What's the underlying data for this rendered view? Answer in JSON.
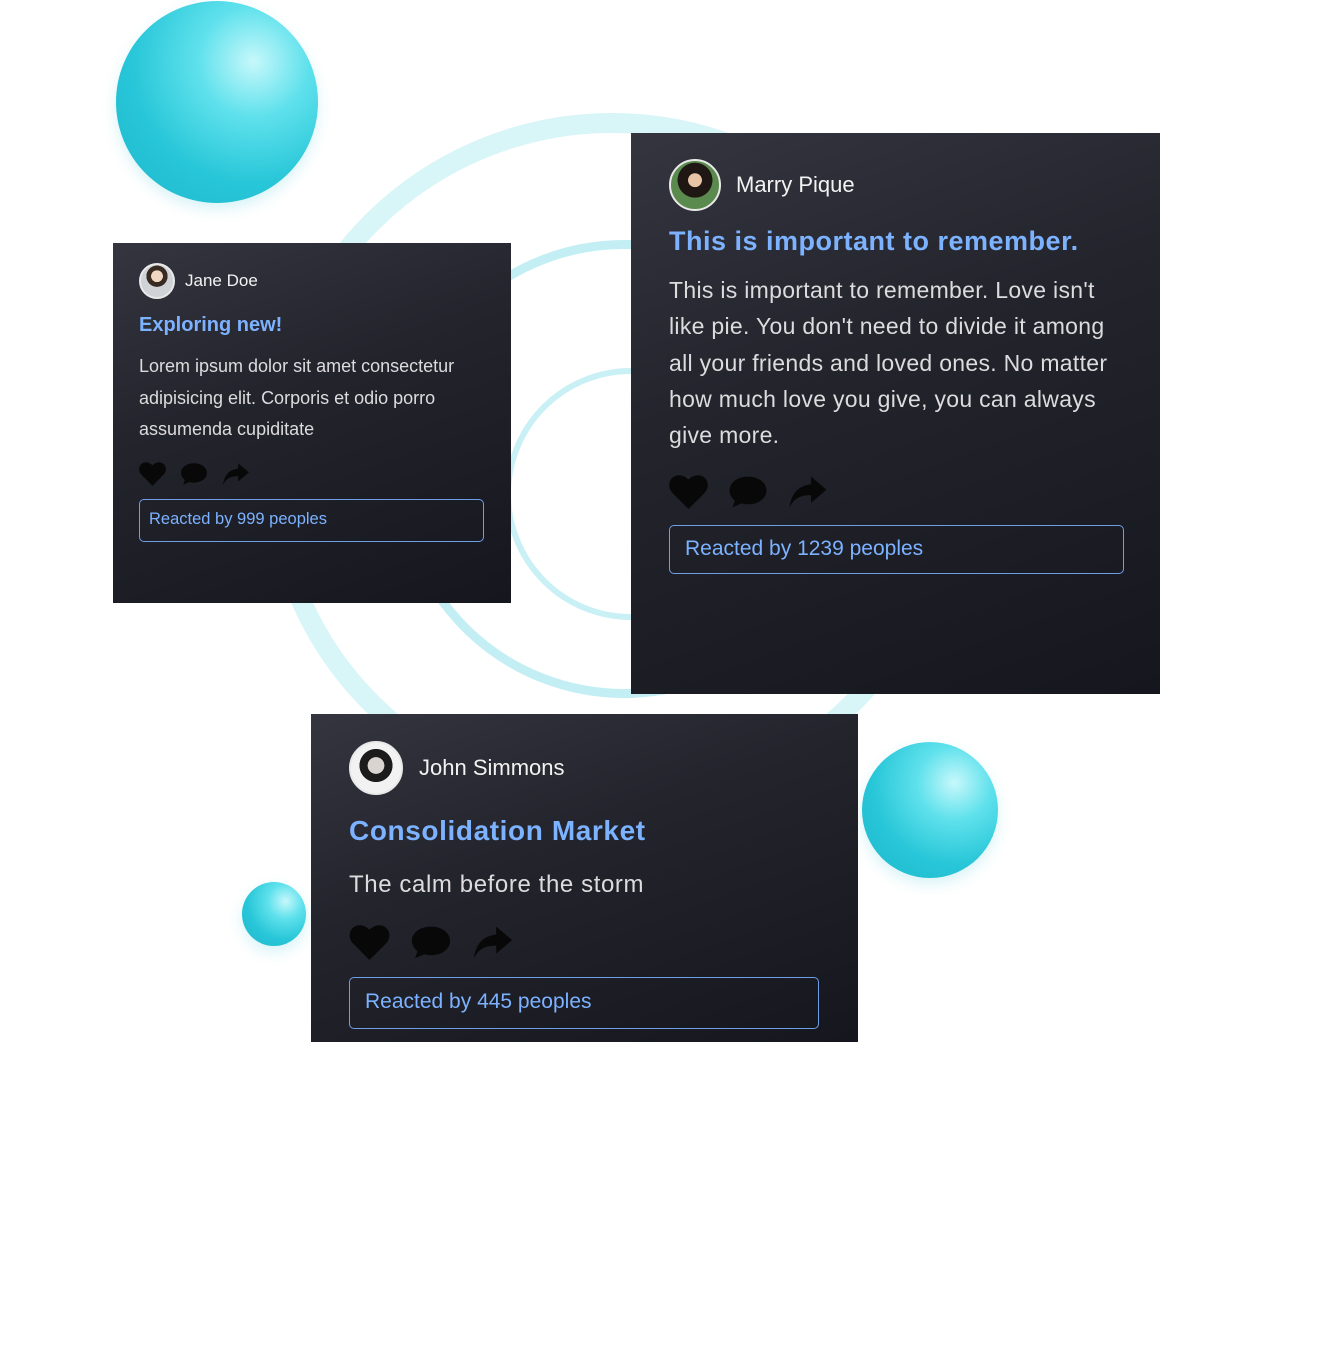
{
  "colors": {
    "card_background": "#23242c",
    "accent_blue": "#7cb2ff",
    "sphere_cyan": "#27c6d8",
    "ring_cyan": "#c6f1f6",
    "text_light": "#dcdcde"
  },
  "cards": [
    {
      "author": "Jane Doe",
      "title": "Exploring new!",
      "body": "Lorem ipsum dolor sit amet consectetur adipisicing elit. Corporis et odio porro assumenda cupiditate",
      "reacted": "Reacted by 999 peoples",
      "icons": [
        "heart-icon",
        "comment-icon",
        "share-icon"
      ]
    },
    {
      "author": "Marry Pique",
      "title": "This is important to remember.",
      "body": "This is important to remember. Love isn't like pie. You don't need to divide it among all your friends and loved ones. No matter how much love you give, you can always give more.",
      "reacted": "Reacted by 1239 peoples",
      "icons": [
        "heart-icon",
        "comment-icon",
        "share-icon"
      ]
    },
    {
      "author": "John Simmons",
      "title": "Consolidation Market",
      "body": "The calm before the storm",
      "reacted": "Reacted by 445 peoples",
      "icons": [
        "heart-icon",
        "comment-icon",
        "share-icon"
      ]
    }
  ]
}
